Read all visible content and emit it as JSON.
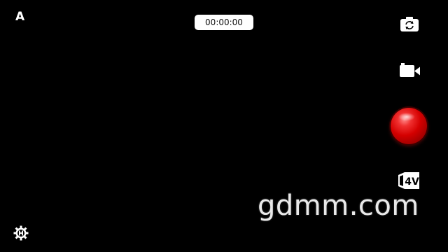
{
  "mode_indicator": {
    "label": "A"
  },
  "recording": {
    "timer": "00:00:00"
  },
  "controls": {
    "switch_camera_icon": "camera-switch-icon",
    "video_mode_icon": "video-camera-icon",
    "record_button_icon": "record-button",
    "quality_badge": {
      "label": "4V",
      "icon": "video-quality-icon"
    },
    "settings_icon": "gear-icon"
  },
  "colors": {
    "background": "#000000",
    "record_red": "#d40000",
    "foreground": "#ffffff"
  },
  "watermark": {
    "text": "gdmm.com"
  }
}
